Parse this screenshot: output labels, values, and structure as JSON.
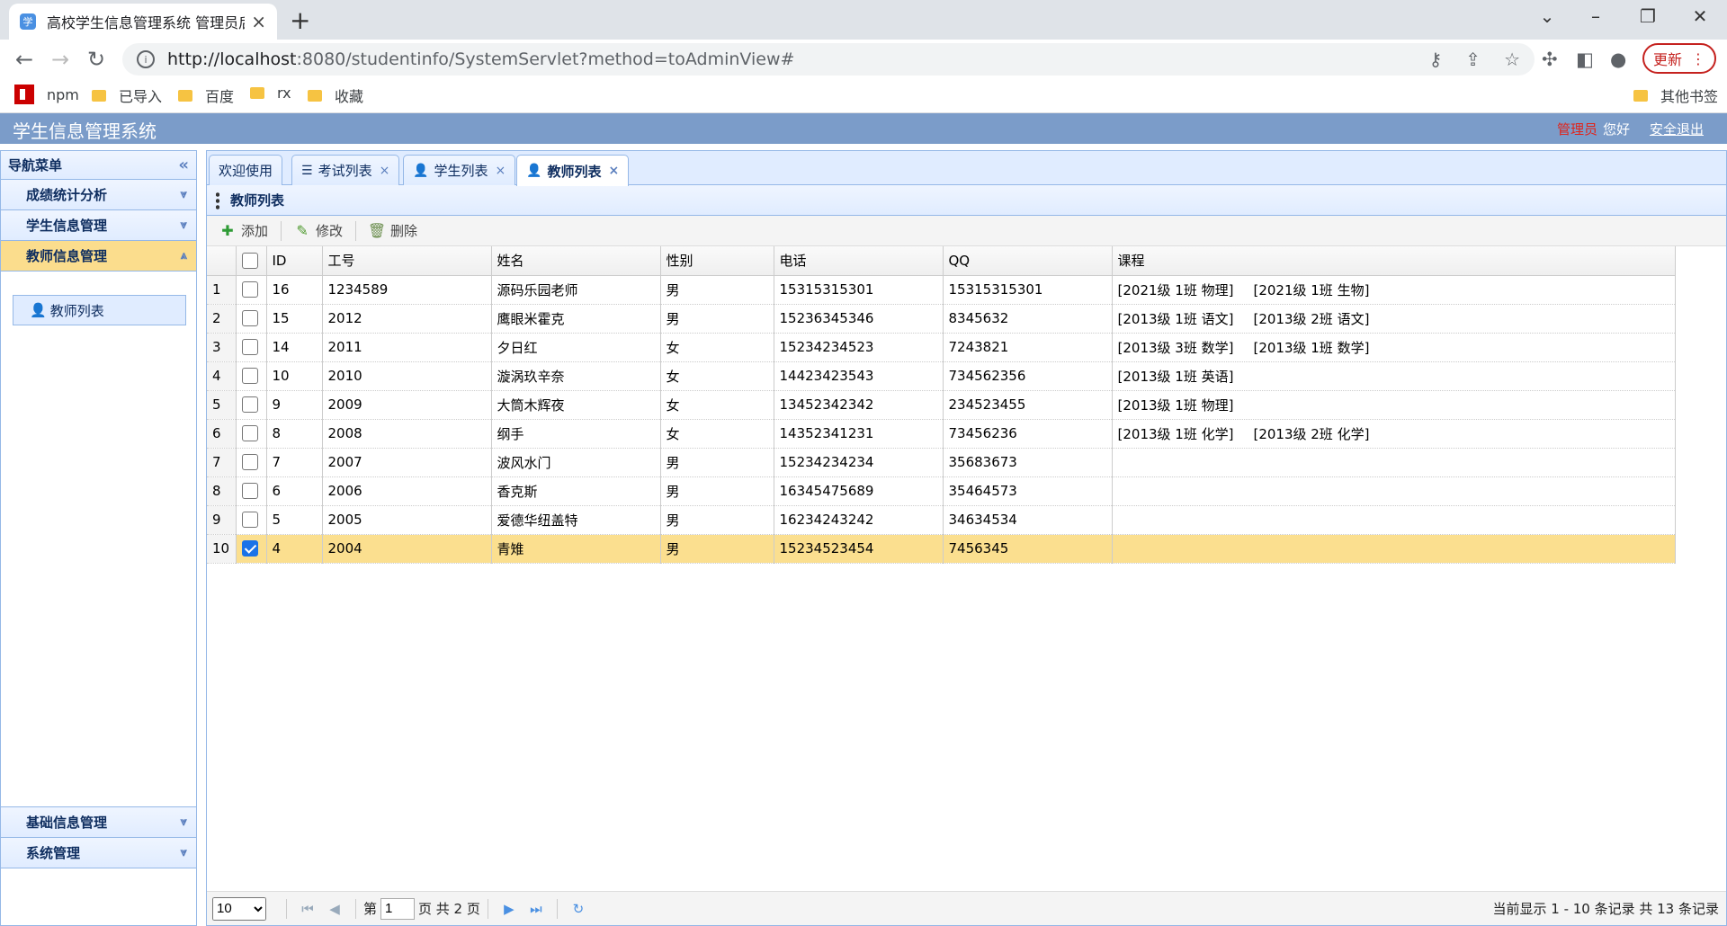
{
  "browser": {
    "tab_title": "高校学生信息管理系统 管理员后台",
    "favicon": "学",
    "url_host": "http://localhost",
    "url_path": ":8080/studentinfo/SystemServlet?method=toAdminView#",
    "update_label": "更新",
    "bookmarks": [
      "npm",
      "已导入",
      "百度",
      "rx",
      "收藏"
    ],
    "other_bookmarks": "其他书签"
  },
  "app": {
    "title": "学生信息管理系统",
    "role": "管理员",
    "greeting": "您好",
    "logout": "安全退出"
  },
  "sidebar": {
    "header": "导航菜单",
    "items": [
      "成绩统计分析",
      "学生信息管理",
      "教师信息管理"
    ],
    "active_link": "教师列表",
    "bottom_items": [
      "基础信息管理",
      "系统管理"
    ]
  },
  "tabs": [
    "欢迎使用",
    "考试列表",
    "学生列表",
    "教师列表"
  ],
  "panel": {
    "title": "教师列表"
  },
  "toolbar": {
    "add": "添加",
    "edit": "修改",
    "delete": "删除"
  },
  "table": {
    "headers": [
      "ID",
      "工号",
      "姓名",
      "性别",
      "电话",
      "QQ",
      "课程"
    ],
    "rows": [
      {
        "n": "1",
        "id": "16",
        "no": "1234589",
        "name": "源码乐园老师",
        "sex": "男",
        "phone": "15315315301",
        "qq": "15315315301",
        "c1": "[2021级 1班 物理]",
        "c2": "[2021级 1班 生物]"
      },
      {
        "n": "2",
        "id": "15",
        "no": "2012",
        "name": "鹰眼米霍克",
        "sex": "男",
        "phone": "15236345346",
        "qq": "8345632",
        "c1": "[2013级 1班 语文]",
        "c2": "[2013级 2班 语文]"
      },
      {
        "n": "3",
        "id": "14",
        "no": "2011",
        "name": "夕日红",
        "sex": "女",
        "phone": "15234234523",
        "qq": "7243821",
        "c1": "[2013级 3班 数学]",
        "c2": "[2013级 1班 数学]"
      },
      {
        "n": "4",
        "id": "10",
        "no": "2010",
        "name": "漩涡玖辛奈",
        "sex": "女",
        "phone": "14423423543",
        "qq": "734562356",
        "c1": "[2013级 1班 英语]",
        "c2": ""
      },
      {
        "n": "5",
        "id": "9",
        "no": "2009",
        "name": "大筒木辉夜",
        "sex": "女",
        "phone": "13452342342",
        "qq": "234523455",
        "c1": "[2013级 1班 物理]",
        "c2": ""
      },
      {
        "n": "6",
        "id": "8",
        "no": "2008",
        "name": "纲手",
        "sex": "女",
        "phone": "14352341231",
        "qq": "73456236",
        "c1": "[2013级 1班 化学]",
        "c2": "[2013级 2班 化学]"
      },
      {
        "n": "7",
        "id": "7",
        "no": "2007",
        "name": "波风水门",
        "sex": "男",
        "phone": "15234234234",
        "qq": "35683673",
        "c1": "",
        "c2": ""
      },
      {
        "n": "8",
        "id": "6",
        "no": "2006",
        "name": "香克斯",
        "sex": "男",
        "phone": "16345475689",
        "qq": "35464573",
        "c1": "",
        "c2": ""
      },
      {
        "n": "9",
        "id": "5",
        "no": "2005",
        "name": "爱德华纽盖特",
        "sex": "男",
        "phone": "16234243242",
        "qq": "34634534",
        "c1": "",
        "c2": ""
      },
      {
        "n": "10",
        "id": "4",
        "no": "2004",
        "name": "青雉",
        "sex": "男",
        "phone": "15234523454",
        "qq": "7456345",
        "c1": "",
        "c2": "",
        "selected": true
      }
    ]
  },
  "pager": {
    "page_size": "10",
    "page_prefix": "第",
    "page_value": "1",
    "page_suffix": "页 共 2 页",
    "info": "当前显示 1 - 10 条记录 共 13 条记录"
  }
}
